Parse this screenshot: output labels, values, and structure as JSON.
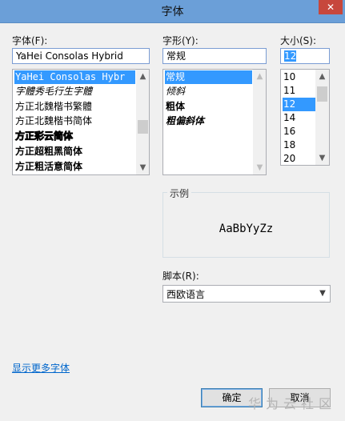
{
  "window": {
    "title": "字体",
    "close_glyph": "✕"
  },
  "font": {
    "label": "字体(F):",
    "value": "YaHei Consolas Hybrid",
    "items": [
      "YaHei Consolas Hybr",
      "字體秀毛行生字體",
      "方正北魏楷书繁體",
      "方正北魏楷书简体",
      "方正彩云简体",
      "方正超粗黑简体",
      "方正粗活意简体"
    ],
    "selected_index": 0
  },
  "style": {
    "label": "字形(Y):",
    "value": "常规",
    "items": [
      "常规",
      "倾斜",
      "粗体",
      "粗偏斜体"
    ],
    "selected_index": 0
  },
  "size": {
    "label": "大小(S):",
    "value": "12",
    "items": [
      "10",
      "11",
      "12",
      "14",
      "16",
      "18",
      "20"
    ],
    "selected_index": 2
  },
  "sample": {
    "caption": "示例",
    "text": "AaBbYyZz"
  },
  "script": {
    "label": "脚本(R):",
    "value": "西欧语言"
  },
  "more_fonts_link": "显示更多字体",
  "buttons": {
    "ok": "确定",
    "cancel": "取消"
  },
  "watermark": "华为云社区",
  "icons": {
    "scroll_up": "▲",
    "scroll_down": "▼",
    "combo_arrow": "▼"
  }
}
